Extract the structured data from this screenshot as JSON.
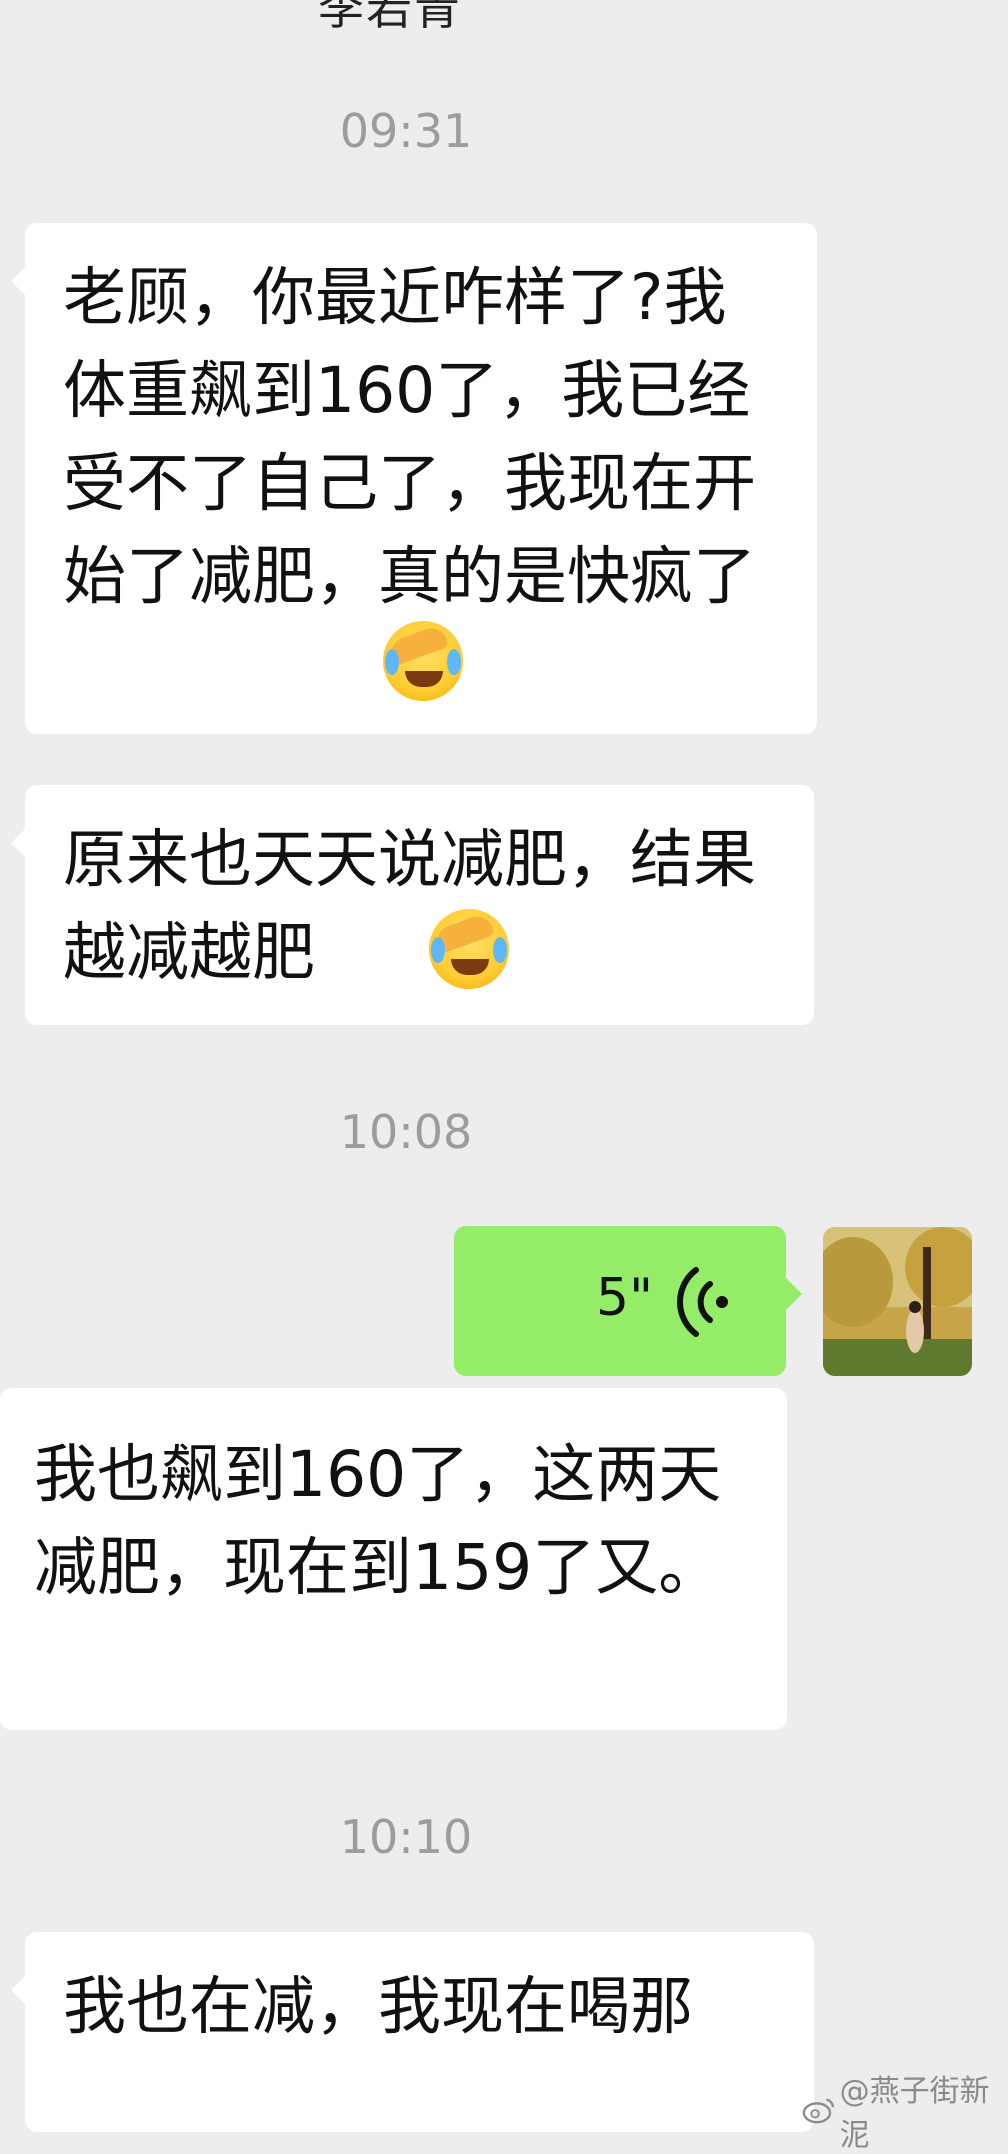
{
  "contact": {
    "name": "李若青"
  },
  "timestamps": [
    "09:31",
    "10:08",
    "10:10"
  ],
  "messages": [
    {
      "text": "老顾，你最近咋样了?我体重飙到160了，我已经受不了自己了，我现在开始了减肥，真的是快疯了",
      "emoji": "face-palm-crying-emoji"
    },
    {
      "text": "原来也天天说减肥，结果越减越肥",
      "emoji": "face-palm-crying-emoji"
    },
    {
      "voice_duration": "5\""
    },
    {
      "text": "我也飙到160了，这两天减肥，现在到159了又。"
    },
    {
      "text": "我也在减，我现在喝那"
    }
  ],
  "watermark": {
    "text": "@燕子街新泥",
    "icon": "weibo-icon"
  },
  "colors": {
    "background": "#ededed",
    "bubble_in": "#ffffff",
    "bubble_out": "#95ec69"
  }
}
